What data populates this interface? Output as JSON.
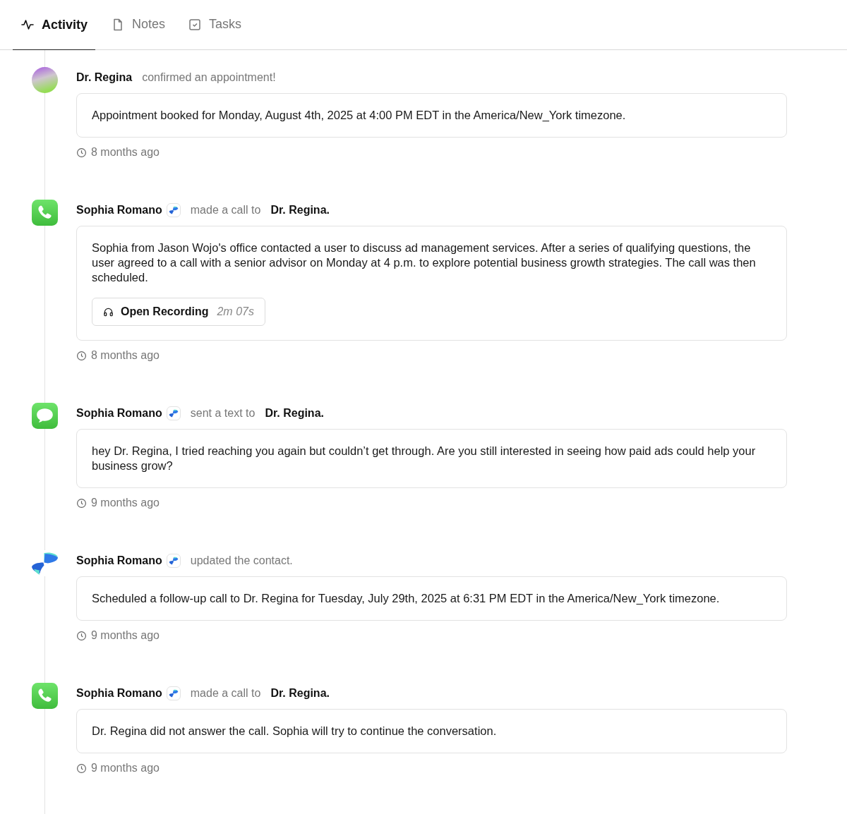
{
  "tabs": [
    {
      "label": "Activity",
      "kind": "activity",
      "selected": true
    },
    {
      "label": "Notes",
      "kind": "note",
      "selected": false
    },
    {
      "label": "Tasks",
      "kind": "task",
      "selected": false
    }
  ],
  "entries": [
    {
      "kind": "avatar",
      "actor": "Dr. Regina",
      "actor_badge": false,
      "action": "confirmed an appointment!",
      "body": "Appointment booked for Monday, August 4th, 2025 at 4:00 PM EDT in the America/New_York timezone.",
      "time": "8 months ago"
    },
    {
      "kind": "phone",
      "actor": "Sophia Romano",
      "actor_badge": true,
      "action": "made a call to",
      "target": "Dr. Regina.",
      "body": "Sophia from Jason Wojo's office contacted a user to discuss ad management services. After a series of qualifying questions, the user agreed to a call with a senior advisor on Monday at 4 p.m. to explore potential business growth strategies. The call was then scheduled.",
      "recording": {
        "label": "Open Recording",
        "duration": "2m 07s"
      },
      "time": "8 months ago"
    },
    {
      "kind": "message",
      "actor": "Sophia Romano",
      "actor_badge": true,
      "action": "sent a text to",
      "target": "Dr. Regina.",
      "body": "hey Dr. Regina, I tried reaching you again but couldn’t get through. Are you still interested in seeing how paid ads could help your business grow?",
      "time": "9 months ago"
    },
    {
      "kind": "logo",
      "actor": "Sophia Romano",
      "actor_badge": true,
      "action": "updated the contact.",
      "body": "Scheduled a follow-up call to Dr. Regina for Tuesday, July 29th, 2025 at 6:31 PM EDT in the America/New_York timezone.",
      "time": "9 months ago"
    },
    {
      "kind": "phone",
      "actor": "Sophia Romano",
      "actor_badge": true,
      "action": "made a call to",
      "target": "Dr. Regina.",
      "body": "Dr. Regina did not answer the call. Sophia will try to continue the conversation.",
      "time": "9 months ago"
    }
  ]
}
